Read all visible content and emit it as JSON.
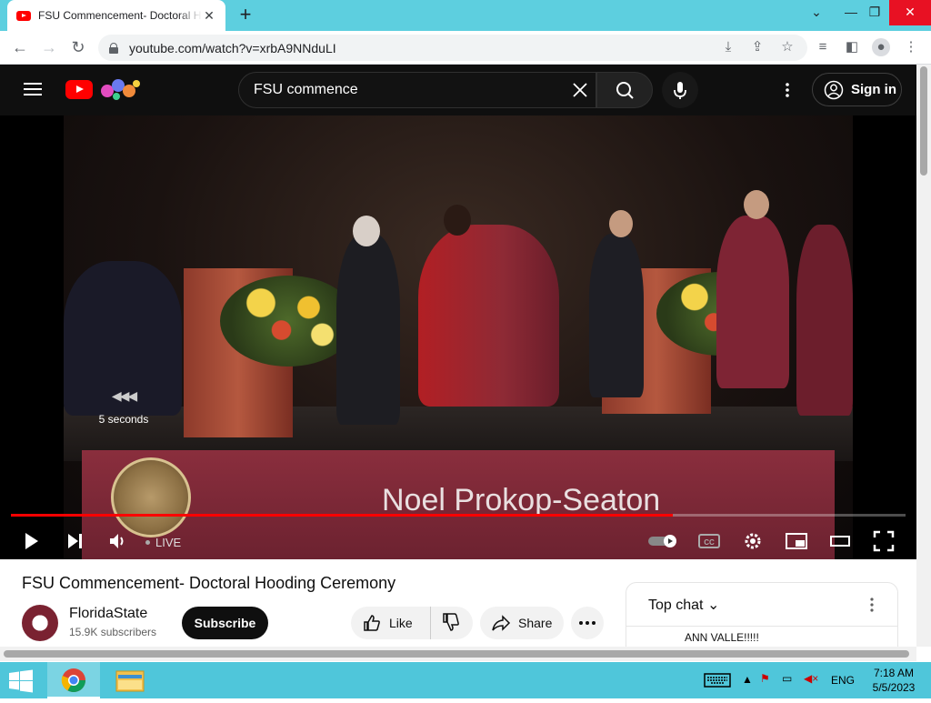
{
  "browser": {
    "tab_title": "FSU Commencement- Doctoral Hooding Ceremony - YouTube",
    "url": "youtube.com/watch?v=xrbA9NNduLI",
    "new_tab_label": "+"
  },
  "youtube": {
    "search_query": "FSU commence",
    "sign_in_label": "Sign in"
  },
  "player": {
    "seek_text": "5 seconds",
    "lower_third_name": "Noel Prokop-Seaton",
    "live_label": "LIVE",
    "progress_fraction": 0.74
  },
  "video": {
    "title": "FSU Commencement- Doctoral Hooding Ceremony",
    "channel_name": "FloridaState",
    "subscribers": "15.9K subscribers",
    "subscribe_label": "Subscribe",
    "like_label": "Like",
    "share_label": "Share"
  },
  "chat": {
    "title": "Top chat",
    "messages": [
      "ANN VALLE!!!!!"
    ]
  },
  "taskbar": {
    "lang": "ENG",
    "time": "7:18 AM",
    "date": "5/5/2023"
  },
  "colors": {
    "accent_red": "#ff0000",
    "taskbar": "#4fc6da",
    "tabstrip": "#5dcfdf"
  }
}
